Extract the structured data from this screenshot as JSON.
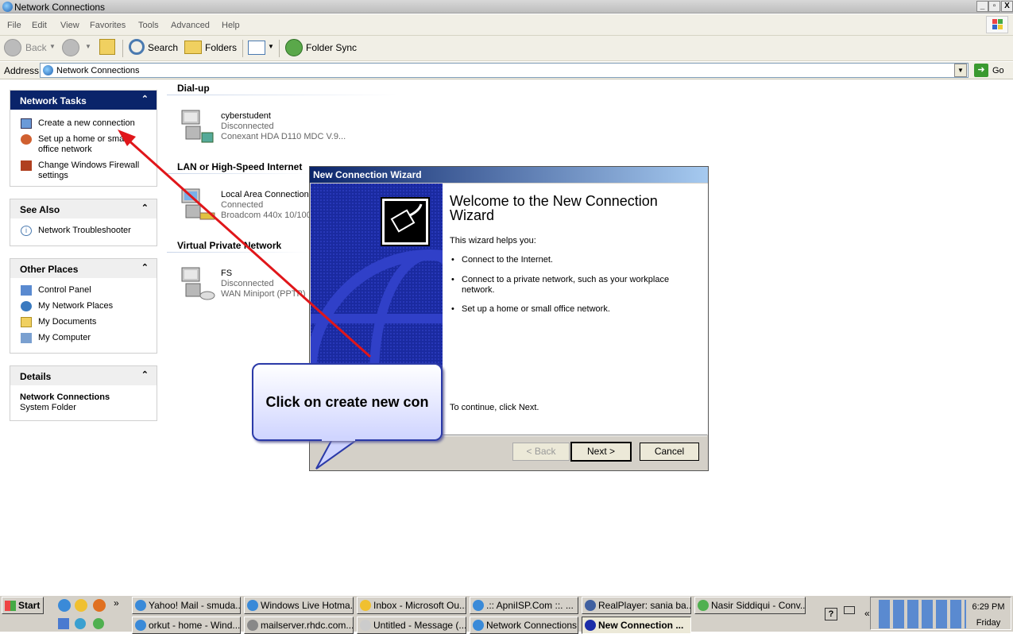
{
  "window": {
    "title": "Network Connections",
    "min_label": "_",
    "max_label": "▫",
    "close_label": "X"
  },
  "menu": [
    "File",
    "Edit",
    "View",
    "Favorites",
    "Tools",
    "Advanced",
    "Help"
  ],
  "toolbar": {
    "back": "Back",
    "search": "Search",
    "folders": "Folders",
    "folder_sync": "Folder Sync"
  },
  "address": {
    "label": "Address",
    "value": "Network Connections",
    "go": "Go"
  },
  "network_tasks": {
    "title": "Network Tasks",
    "items": [
      "Create a new connection",
      "Set up a home or small office network",
      "Change Windows Firewall settings"
    ]
  },
  "see_also": {
    "title": "See Also",
    "items": [
      "Network Troubleshooter"
    ]
  },
  "other_places": {
    "title": "Other Places",
    "items": [
      "Control Panel",
      "My Network Places",
      "My Documents",
      "My Computer"
    ]
  },
  "details": {
    "title": "Details",
    "name": "Network Connections",
    "type": "System Folder"
  },
  "groups": [
    {
      "header": "Dial-up",
      "name": "cyberstudent",
      "status": "Disconnected",
      "device": "Conexant HDA D110 MDC V.9..."
    },
    {
      "header": "LAN or High-Speed Internet",
      "name": "Local Area Connection",
      "status": "Connected",
      "device": "Broadcom 440x 10/100"
    },
    {
      "header": "Virtual Private Network",
      "name": "FS",
      "status": "Disconnected",
      "device": "WAN Miniport (PPTP)"
    }
  ],
  "wizard": {
    "title": "New Connection Wizard",
    "heading": "Welcome to the New Connection Wizard",
    "intro": "This wizard helps you:",
    "bullets": [
      "Connect to the Internet.",
      "Connect to a private network, such as your workplace network.",
      "Set up a home or small office network."
    ],
    "continue": "To continue, click Next.",
    "back": "< Back",
    "next": "Next >",
    "cancel": "Cancel"
  },
  "callout": {
    "text": "Click on create new con"
  },
  "taskbar": {
    "start": "Start",
    "chevron": "»",
    "row1": [
      "Yahoo! Mail - smuda...",
      "Windows Live Hotma...",
      "Inbox - Microsoft Ou...",
      ".:: ApniISP.Com ::. ...",
      "RealPlayer: sania ba...",
      "Nasir Siddiqui - Conv..."
    ],
    "row2": [
      "orkut - home - Wind...",
      "mailserver.rhdc.com...",
      "Untitled - Message (...",
      "Network Connections",
      "New Connection ..."
    ],
    "clock_time": "6:29 PM",
    "clock_day": "Friday",
    "tray_chevron": "«"
  },
  "colors": {
    "accent": "#0a246a",
    "callout_border": "#2b3aa8",
    "arrow": "#e0161a"
  }
}
